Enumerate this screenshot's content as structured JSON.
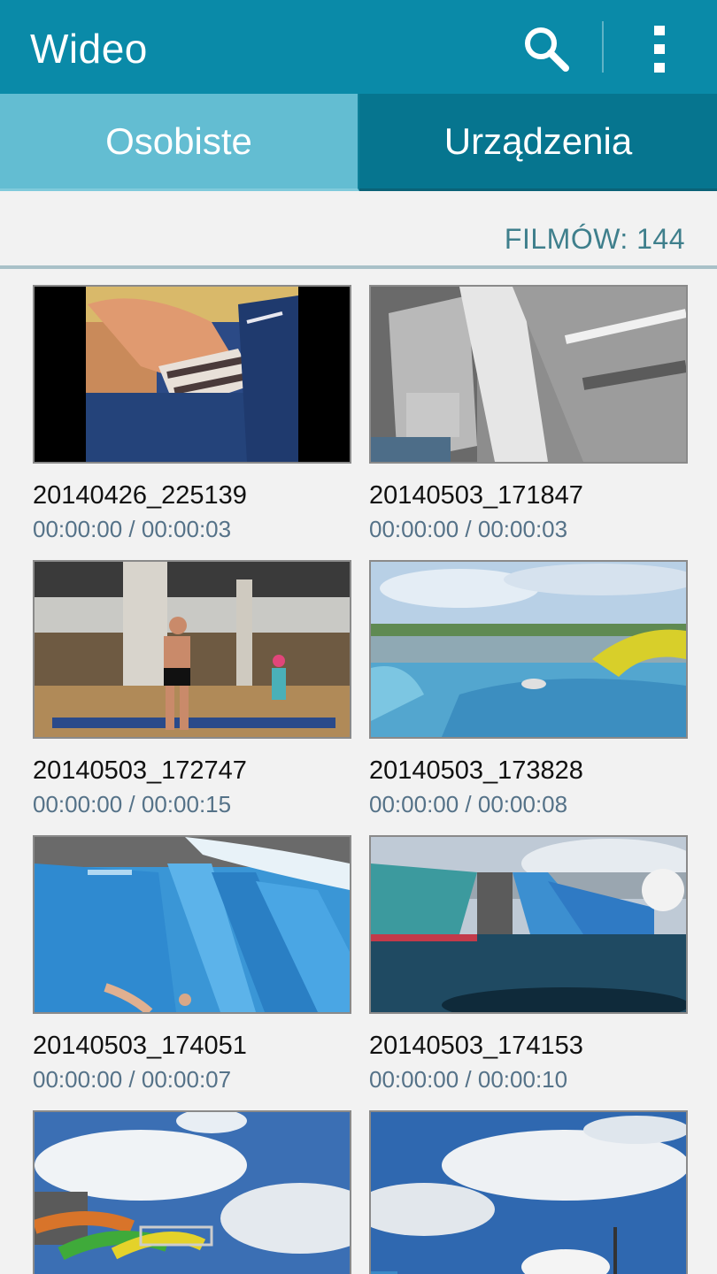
{
  "app": {
    "title": "Wideo",
    "search_icon": "search-icon",
    "more_icon": "more-vert-icon",
    "accent": "#0a8aa8"
  },
  "tabs": [
    {
      "label": "Osobiste",
      "active": true
    },
    {
      "label": "Urządzenia",
      "active": false
    }
  ],
  "count": {
    "label": "FILMÓW: 144"
  },
  "videos": [
    {
      "name": "20140426_225139",
      "time": "00:00:00 / 00:00:03"
    },
    {
      "name": "20140503_171847",
      "time": "00:00:00 / 00:00:03"
    },
    {
      "name": "20140503_172747",
      "time": "00:00:00 / 00:00:15"
    },
    {
      "name": "20140503_173828",
      "time": "00:00:00 / 00:00:08"
    },
    {
      "name": "20140503_174051",
      "time": "00:00:00 / 00:00:07"
    },
    {
      "name": "20140503_174153",
      "time": "00:00:00 / 00:00:10"
    },
    {
      "name": "",
      "time": ""
    },
    {
      "name": "",
      "time": ""
    }
  ]
}
